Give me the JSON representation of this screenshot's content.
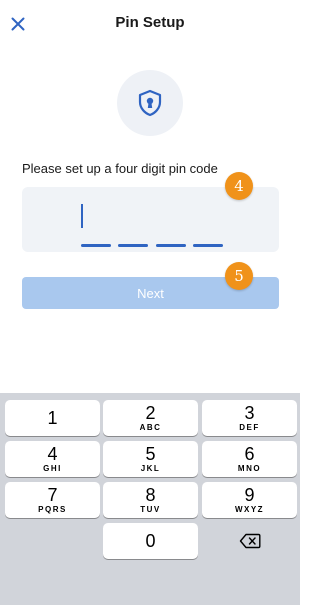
{
  "header": {
    "title": "Pin Setup"
  },
  "prompt": "Please set up a four digit pin code",
  "pin": {
    "digits_entered": 0,
    "length": 4
  },
  "steps": {
    "pin_input": "4",
    "next_button": "5"
  },
  "next_button": {
    "label": "Next",
    "enabled": false
  },
  "keypad": {
    "keys": [
      {
        "num": "1",
        "letters": ""
      },
      {
        "num": "2",
        "letters": "ABC"
      },
      {
        "num": "3",
        "letters": "DEF"
      },
      {
        "num": "4",
        "letters": "GHI"
      },
      {
        "num": "5",
        "letters": "JKL"
      },
      {
        "num": "6",
        "letters": "MNO"
      },
      {
        "num": "7",
        "letters": "PQRS"
      },
      {
        "num": "8",
        "letters": "TUV"
      },
      {
        "num": "9",
        "letters": "WXYZ"
      },
      {
        "num": "0",
        "letters": ""
      }
    ]
  },
  "colors": {
    "accent": "#2f64c2",
    "step_badge": "#f0921a",
    "next_disabled": "#a9c8ee",
    "keypad_bg": "#d1d4da"
  },
  "icons": {
    "close": "close-icon",
    "shield": "shield-keyhole-icon",
    "delete": "backspace-icon"
  }
}
